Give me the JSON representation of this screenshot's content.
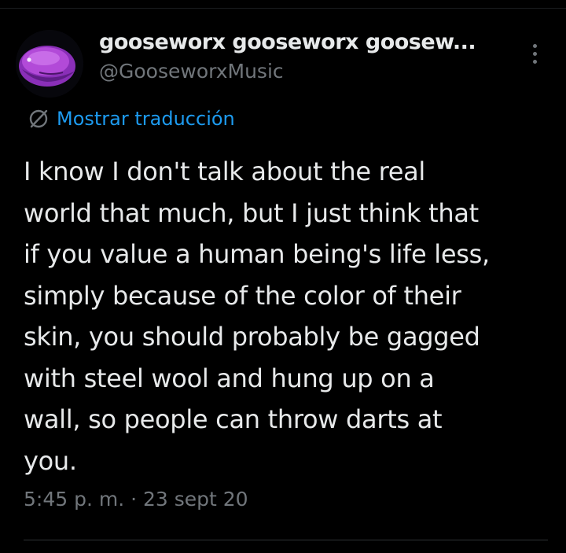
{
  "tweet": {
    "display_name": "gooseworx gooseworx goosew...",
    "handle": "@GooseworxMusic",
    "translate_label": "Mostrar traducción",
    "body": "I know I don't talk about the real\nworld that much, but I just think that\nif you value a human being's life less,\nsimply because of the color of their\nskin, you should probably be gagged\nwith steel wool and hung up on a\nwall, so people can throw darts at\nyou.",
    "timestamp": "5:45 p. m. · 23 sept 20"
  },
  "icons": {
    "avatar": "purple-creature-avatar",
    "more": "more-vertical-icon",
    "translate": "globe-translate-icon"
  },
  "colors": {
    "background": "#000000",
    "text_primary": "#e7e9ea",
    "text_secondary": "#71767b",
    "link": "#1d9bf0",
    "avatar_accent": "#b24ad8"
  }
}
